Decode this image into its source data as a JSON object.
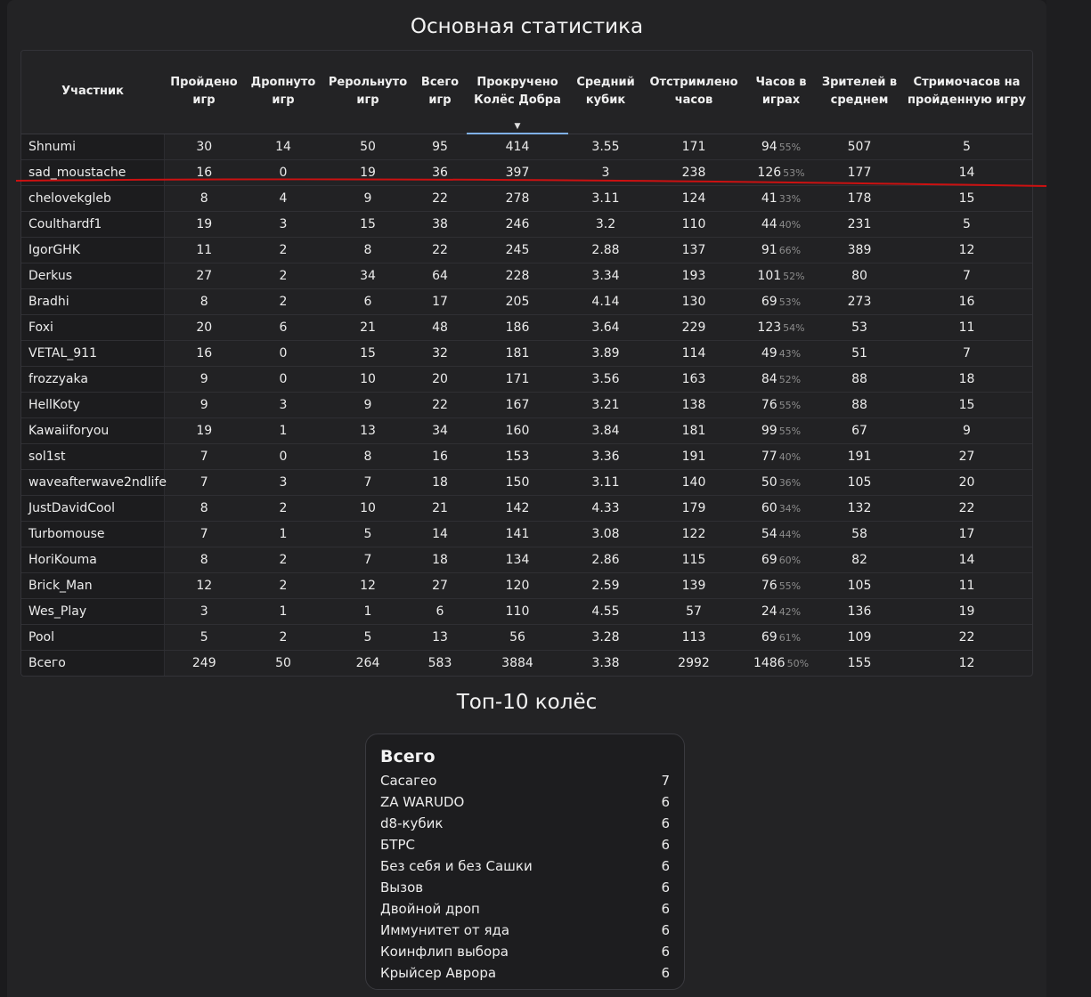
{
  "title": "Основная статистика",
  "columns": [
    "Участник",
    "Пройдено игр",
    "Дропнуто игр",
    "Рерольнуто игр",
    "Всего игр",
    "Прокручено Колёс Добра",
    "Средний кубик",
    "Отстримлено часов",
    "Часов в играх",
    "Зрителей в среднем",
    "Стримочасов на пройденную игру"
  ],
  "sort_indicator": "▼",
  "rows": [
    {
      "name": "Shnumi",
      "completed": "30",
      "dropped": "14",
      "rerolled": "50",
      "total": "95",
      "wheels": "414",
      "dice": "3.55",
      "streamed": "171",
      "game_hours": "94",
      "game_pct": "55%",
      "viewers": "507",
      "per_game": "5"
    },
    {
      "name": "sad_moustache",
      "completed": "16",
      "dropped": "0",
      "rerolled": "19",
      "total": "36",
      "wheels": "397",
      "dice": "3",
      "streamed": "238",
      "game_hours": "126",
      "game_pct": "53%",
      "viewers": "177",
      "per_game": "14"
    },
    {
      "name": "chelovekgleb",
      "completed": "8",
      "dropped": "4",
      "rerolled": "9",
      "total": "22",
      "wheels": "278",
      "dice": "3.11",
      "streamed": "124",
      "game_hours": "41",
      "game_pct": "33%",
      "viewers": "178",
      "per_game": "15"
    },
    {
      "name": "Coulthardf1",
      "completed": "19",
      "dropped": "3",
      "rerolled": "15",
      "total": "38",
      "wheels": "246",
      "dice": "3.2",
      "streamed": "110",
      "game_hours": "44",
      "game_pct": "40%",
      "viewers": "231",
      "per_game": "5"
    },
    {
      "name": "IgorGHK",
      "completed": "11",
      "dropped": "2",
      "rerolled": "8",
      "total": "22",
      "wheels": "245",
      "dice": "2.88",
      "streamed": "137",
      "game_hours": "91",
      "game_pct": "66%",
      "viewers": "389",
      "per_game": "12"
    },
    {
      "name": "Derkus",
      "completed": "27",
      "dropped": "2",
      "rerolled": "34",
      "total": "64",
      "wheels": "228",
      "dice": "3.34",
      "streamed": "193",
      "game_hours": "101",
      "game_pct": "52%",
      "viewers": "80",
      "per_game": "7"
    },
    {
      "name": "Bradhi",
      "completed": "8",
      "dropped": "2",
      "rerolled": "6",
      "total": "17",
      "wheels": "205",
      "dice": "4.14",
      "streamed": "130",
      "game_hours": "69",
      "game_pct": "53%",
      "viewers": "273",
      "per_game": "16"
    },
    {
      "name": "Foxi",
      "completed": "20",
      "dropped": "6",
      "rerolled": "21",
      "total": "48",
      "wheels": "186",
      "dice": "3.64",
      "streamed": "229",
      "game_hours": "123",
      "game_pct": "54%",
      "viewers": "53",
      "per_game": "11"
    },
    {
      "name": "VETAL_911",
      "completed": "16",
      "dropped": "0",
      "rerolled": "15",
      "total": "32",
      "wheels": "181",
      "dice": "3.89",
      "streamed": "114",
      "game_hours": "49",
      "game_pct": "43%",
      "viewers": "51",
      "per_game": "7"
    },
    {
      "name": "frozzyaka",
      "completed": "9",
      "dropped": "0",
      "rerolled": "10",
      "total": "20",
      "wheels": "171",
      "dice": "3.56",
      "streamed": "163",
      "game_hours": "84",
      "game_pct": "52%",
      "viewers": "88",
      "per_game": "18"
    },
    {
      "name": "HellKoty",
      "completed": "9",
      "dropped": "3",
      "rerolled": "9",
      "total": "22",
      "wheels": "167",
      "dice": "3.21",
      "streamed": "138",
      "game_hours": "76",
      "game_pct": "55%",
      "viewers": "88",
      "per_game": "15"
    },
    {
      "name": "Kawaiiforyou",
      "completed": "19",
      "dropped": "1",
      "rerolled": "13",
      "total": "34",
      "wheels": "160",
      "dice": "3.84",
      "streamed": "181",
      "game_hours": "99",
      "game_pct": "55%",
      "viewers": "67",
      "per_game": "9"
    },
    {
      "name": "sol1st",
      "completed": "7",
      "dropped": "0",
      "rerolled": "8",
      "total": "16",
      "wheels": "153",
      "dice": "3.36",
      "streamed": "191",
      "game_hours": "77",
      "game_pct": "40%",
      "viewers": "191",
      "per_game": "27"
    },
    {
      "name": "waveafterwave2ndlife",
      "completed": "7",
      "dropped": "3",
      "rerolled": "7",
      "total": "18",
      "wheels": "150",
      "dice": "3.11",
      "streamed": "140",
      "game_hours": "50",
      "game_pct": "36%",
      "viewers": "105",
      "per_game": "20"
    },
    {
      "name": "JustDavidCool",
      "completed": "8",
      "dropped": "2",
      "rerolled": "10",
      "total": "21",
      "wheels": "142",
      "dice": "4.33",
      "streamed": "179",
      "game_hours": "60",
      "game_pct": "34%",
      "viewers": "132",
      "per_game": "22"
    },
    {
      "name": "Turbomouse",
      "completed": "7",
      "dropped": "1",
      "rerolled": "5",
      "total": "14",
      "wheels": "141",
      "dice": "3.08",
      "streamed": "122",
      "game_hours": "54",
      "game_pct": "44%",
      "viewers": "58",
      "per_game": "17"
    },
    {
      "name": "HoriKouma",
      "completed": "8",
      "dropped": "2",
      "rerolled": "7",
      "total": "18",
      "wheels": "134",
      "dice": "2.86",
      "streamed": "115",
      "game_hours": "69",
      "game_pct": "60%",
      "viewers": "82",
      "per_game": "14"
    },
    {
      "name": "Brick_Man",
      "completed": "12",
      "dropped": "2",
      "rerolled": "12",
      "total": "27",
      "wheels": "120",
      "dice": "2.59",
      "streamed": "139",
      "game_hours": "76",
      "game_pct": "55%",
      "viewers": "105",
      "per_game": "11"
    },
    {
      "name": "Wes_Play",
      "completed": "3",
      "dropped": "1",
      "rerolled": "1",
      "total": "6",
      "wheels": "110",
      "dice": "4.55",
      "streamed": "57",
      "game_hours": "24",
      "game_pct": "42%",
      "viewers": "136",
      "per_game": "19"
    },
    {
      "name": "Pool",
      "completed": "5",
      "dropped": "2",
      "rerolled": "5",
      "total": "13",
      "wheels": "56",
      "dice": "3.28",
      "streamed": "113",
      "game_hours": "69",
      "game_pct": "61%",
      "viewers": "109",
      "per_game": "22"
    },
    {
      "name": "Всего",
      "completed": "249",
      "dropped": "50",
      "rerolled": "264",
      "total": "583",
      "wheels": "3884",
      "dice": "3.38",
      "streamed": "2992",
      "game_hours": "1486",
      "game_pct": "50%",
      "viewers": "155",
      "per_game": "12"
    }
  ],
  "top10": {
    "title": "Топ-10 колёс",
    "card_title": "Всего",
    "items": [
      {
        "label": "Сасагео",
        "count": "7"
      },
      {
        "label": "ZA WARUDO",
        "count": "6"
      },
      {
        "label": "d8-кубик",
        "count": "6"
      },
      {
        "label": "БТРС",
        "count": "6"
      },
      {
        "label": "Без себя и без Сашки",
        "count": "6"
      },
      {
        "label": "Вызов",
        "count": "6"
      },
      {
        "label": "Двойной дроп",
        "count": "6"
      },
      {
        "label": "Иммунитет от яда",
        "count": "6"
      },
      {
        "label": "Коинфлип выбора",
        "count": "6"
      },
      {
        "label": "Крыйсер Аврора",
        "count": "6"
      }
    ]
  },
  "colors": {
    "background": "#1b1b1d",
    "panel": "#232325",
    "sort_underline": "#7fb0e8",
    "annotation_line": "#cc1111"
  }
}
